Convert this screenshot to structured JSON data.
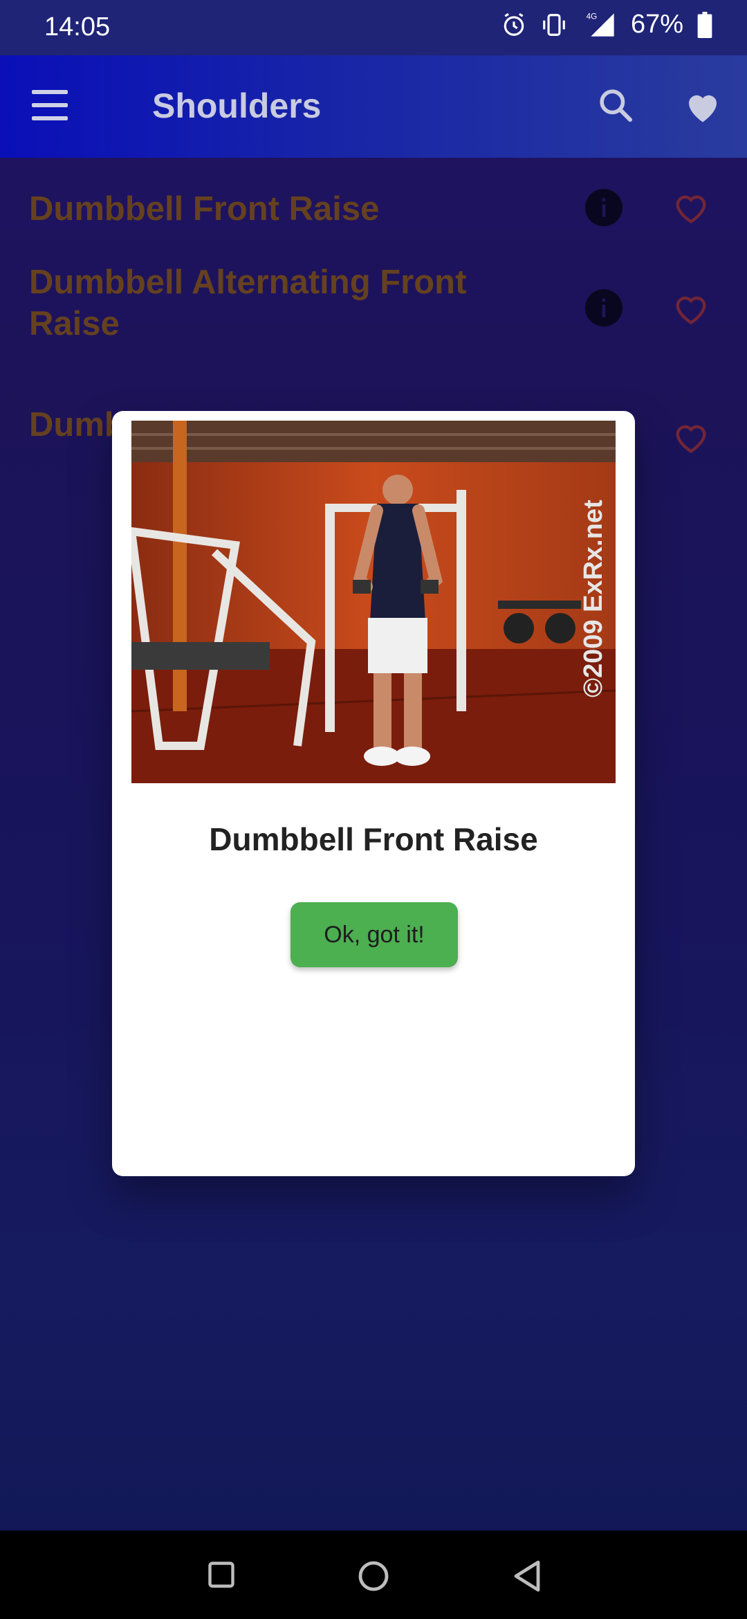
{
  "status_bar": {
    "time": "14:05",
    "network": "4G",
    "battery": "67%",
    "icons": [
      "alarm-icon",
      "vibrate-icon",
      "signal-icon",
      "battery-icon"
    ]
  },
  "app_bar": {
    "title": "Shoulders",
    "icons": [
      "menu-icon",
      "search-icon",
      "favorites-icon"
    ]
  },
  "exercises": [
    {
      "title": "Dumbbell Front Raise"
    },
    {
      "title": "Dumbbell Alternating Front Raise"
    },
    {
      "title": "Dumbbell Front Raise"
    }
  ],
  "dialog": {
    "image_watermark": "©2009 ExRx.net",
    "title": "Dumbbell Front Raise",
    "button_label": "Ok, got it!"
  },
  "colors": {
    "item_title": "#a86a00",
    "heart": "#c0392b",
    "ok_button": "#4caf50"
  },
  "nav_bar": {
    "icons": [
      "recents-icon",
      "home-icon",
      "back-icon"
    ]
  }
}
